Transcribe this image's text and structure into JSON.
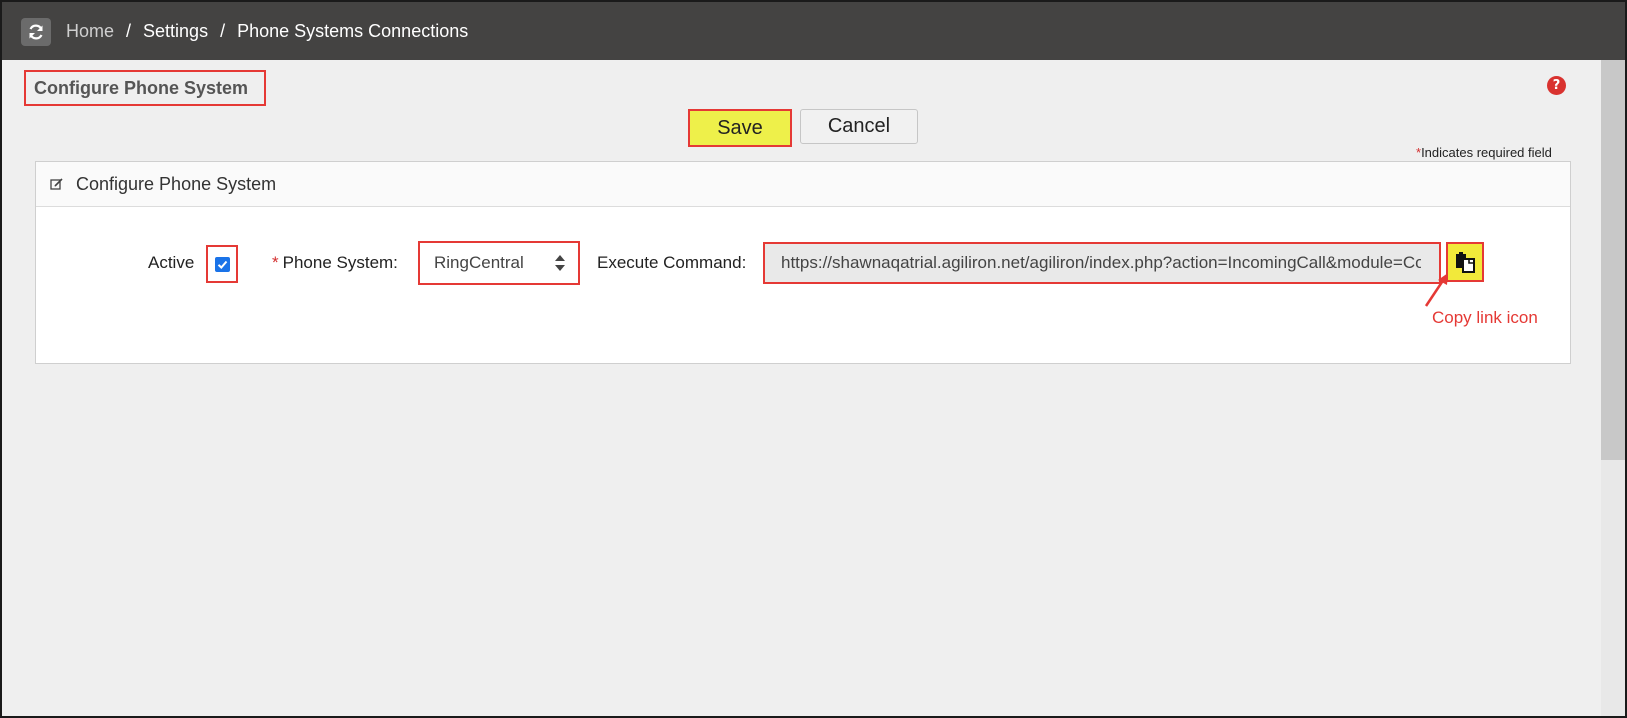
{
  "topbar": {
    "refresh_icon": "refresh-icon",
    "breadcrumb": {
      "home": "Home",
      "separator": "/",
      "settings": "Settings",
      "current": "Phone Systems Connections"
    }
  },
  "header": {
    "page_title": "Configure Phone System",
    "help_icon": "?"
  },
  "actions": {
    "save_label": "Save",
    "cancel_label": "Cancel"
  },
  "required_note": {
    "star": "*",
    "text": "Indicates required field"
  },
  "panel": {
    "title": "Configure Phone System",
    "edit_icon": "edit-icon"
  },
  "form": {
    "active_label": "Active",
    "active_checked": true,
    "phone_system_star": "*",
    "phone_system_label": "Phone System:",
    "phone_system_value": "RingCentral",
    "execute_command_label": "Execute Command:",
    "execute_command_value": "https://shawnaqatrial.agiliron.net/agiliron/index.php?action=IncomingCall&module=Co",
    "copy_icon": "copy-link-icon"
  },
  "annotation": {
    "copy_link_label": "Copy link icon"
  },
  "colors": {
    "topbar": "#444342",
    "highlight": "#e53935",
    "save_button": "#eef04a",
    "copy_button": "#f2e93a",
    "checkbox": "#1a73e8"
  }
}
